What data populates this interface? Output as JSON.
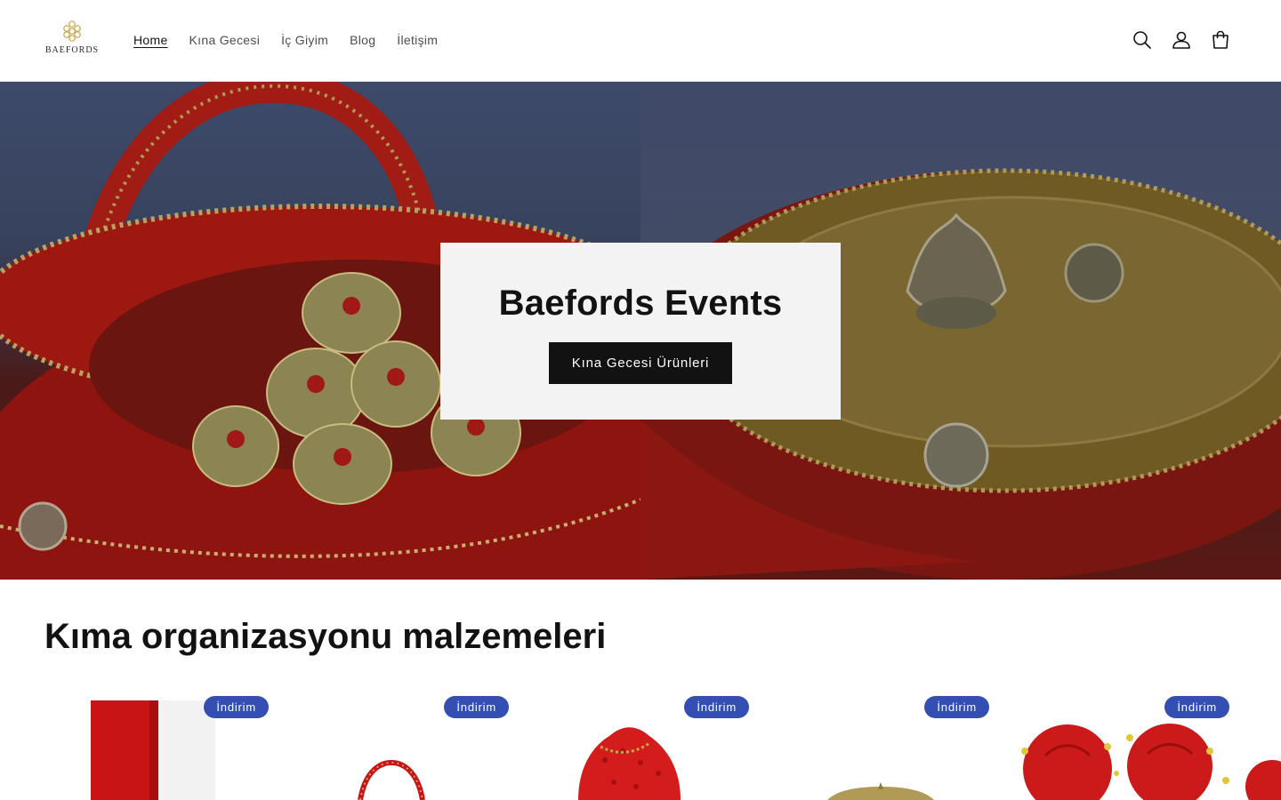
{
  "header": {
    "logo_text": "BAEFORDS",
    "nav": [
      "Home",
      "Kına Gecesi",
      "İç Giyim",
      "Blog",
      "İletişim"
    ],
    "icons": [
      "search-icon",
      "account-icon",
      "cart-icon"
    ]
  },
  "hero": {
    "title": "Baefords Events",
    "button_label": "Kına Gecesi Ürünleri"
  },
  "collection": {
    "title": "Kıma organizasyonu malzemeleri",
    "products": [
      {
        "badge": "İndirim",
        "image": "ribbon-product"
      },
      {
        "badge": "İndirim",
        "image": "basket-product"
      },
      {
        "badge": "İndirim",
        "image": "sequin-pouch-product"
      },
      {
        "badge": "İndirim",
        "image": "tray-product"
      },
      {
        "badge": "İndirim",
        "image": "rose-favor-product"
      }
    ]
  },
  "colors": {
    "badge": "#334fb4",
    "button": "#121212",
    "hero_box": "#f3f3f3"
  }
}
